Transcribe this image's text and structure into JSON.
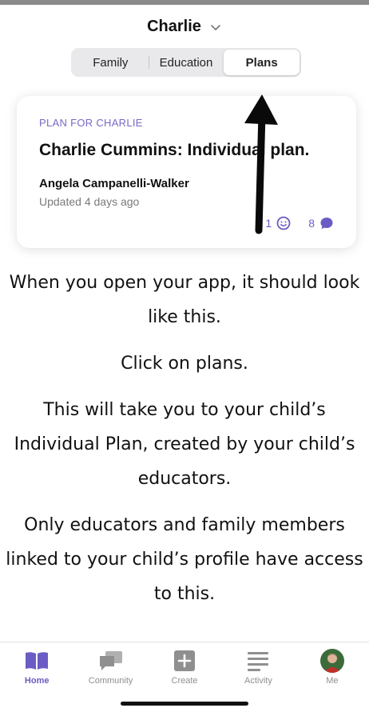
{
  "header": {
    "title": "Charlie"
  },
  "segments": [
    {
      "label": "Family",
      "active": false
    },
    {
      "label": "Education",
      "active": false
    },
    {
      "label": "Plans",
      "active": true
    }
  ],
  "card": {
    "kicker": "PLAN FOR CHARLIE",
    "title": "Charlie Cummins: Individual plan.",
    "author": "Angela Campanelli-Walker",
    "updated": "Updated 4 days ago",
    "reactions_count": "1",
    "comments_count": "8"
  },
  "instructions": [
    "When you open your app, it should look like this.",
    "Click on plans.",
    "This will take you to your child’s Individual Plan, created by your child’s educators.",
    "Only educators and family members linked to your child’s profile have access to this."
  ],
  "tabbar": [
    {
      "label": "Home",
      "icon": "book-icon",
      "active": true
    },
    {
      "label": "Community",
      "icon": "chat-icon",
      "active": false
    },
    {
      "label": "Create",
      "icon": "plus-square-icon",
      "active": false
    },
    {
      "label": "Activity",
      "icon": "lines-icon",
      "active": false
    },
    {
      "label": "Me",
      "icon": "avatar",
      "active": false
    }
  ],
  "colors": {
    "accent": "#6a5cc4",
    "kicker": "#7b68c9",
    "inactive": "#8f8f8f"
  }
}
